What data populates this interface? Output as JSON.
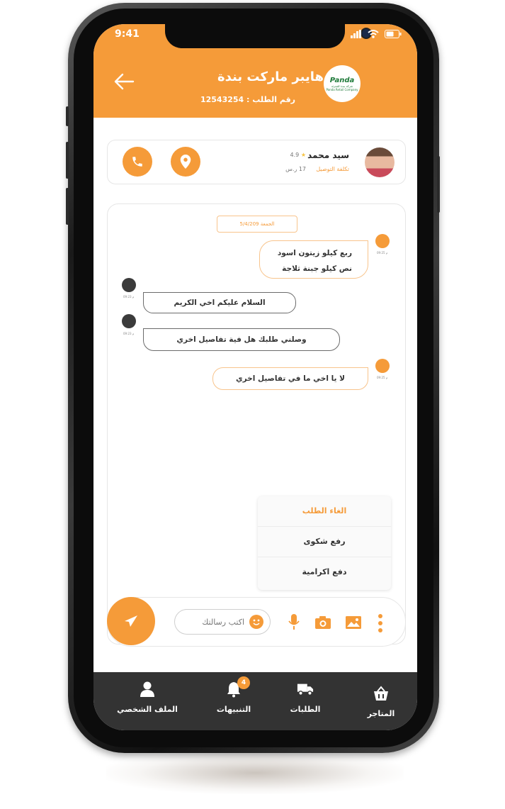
{
  "status_bar": {
    "time": "9:41"
  },
  "header": {
    "store_name": "هايبر ماركت بندة",
    "order_number": "رقم الطلب : 12543254",
    "logo_text": "Panda",
    "logo_subtext": "شركة بندة للتجزئة",
    "logo_subtext_en": "Panda Retail Company"
  },
  "driver": {
    "name": "سيد محمد",
    "rating": "4.9",
    "delivery_label": "تكلفة التوصيل",
    "delivery_cost": "17 ر.س"
  },
  "chat": {
    "date": "الجمعة 5/4/209",
    "messages": [
      {
        "sender": "me",
        "lines": [
          "ربع كيلو زيتون اسود",
          "نص كيلو جبنة ثلاجة"
        ],
        "time": "09:25 م"
      },
      {
        "sender": "driver",
        "lines": [
          "السلام عليكم اخي الكريم"
        ],
        "time": "09:23 م"
      },
      {
        "sender": "driver",
        "lines": [
          "وصلني طلبك هل فية تفاصيل اخري"
        ],
        "time": "09:23 م"
      },
      {
        "sender": "me",
        "lines": [
          "لا يا اخي ما في تفاصيل اخري"
        ],
        "time": "09:25 م"
      }
    ]
  },
  "options_menu": {
    "items": [
      "الغاء الطلب",
      "رفع شكوى",
      "دفع اكرامية"
    ]
  },
  "composer": {
    "placeholder": "اكتب رسالتك"
  },
  "bottom_nav": {
    "items": [
      {
        "label": "الملف الشخصي",
        "icon": "user-icon"
      },
      {
        "label": "التنبيهات",
        "icon": "bell-icon",
        "badge": "4"
      },
      {
        "label": "الطلبات",
        "icon": "truck-icon"
      },
      {
        "label": "المتاجر",
        "icon": "basket-icon"
      }
    ]
  },
  "colors": {
    "accent": "#f59b39",
    "nav_bg": "#333333"
  }
}
